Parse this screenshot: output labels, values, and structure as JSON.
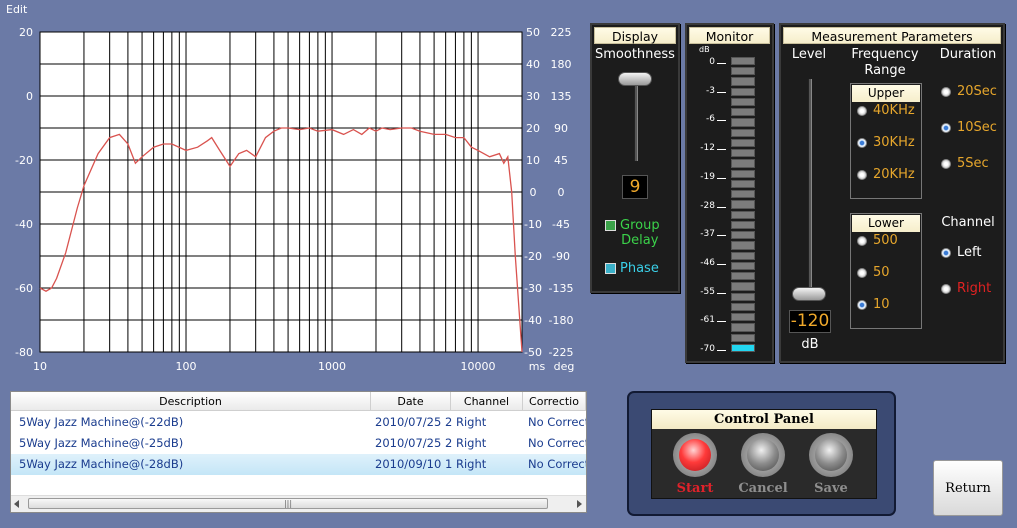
{
  "window": {
    "title": "Edit"
  },
  "chart_data": {
    "type": "line",
    "x_scale": "log",
    "xlim": [
      10,
      20000
    ],
    "x_tick_labels": [
      "10",
      "100",
      "1000",
      "10000"
    ],
    "x_unit_labels": [
      "ms",
      "deg"
    ],
    "y_left": {
      "ylim": [
        -80,
        20
      ],
      "tick_labels": [
        "20",
        "0",
        "-20",
        "-40",
        "-60",
        "-80"
      ]
    },
    "y_right_ms": {
      "ylim": [
        -50,
        50
      ],
      "tick_labels": [
        "50",
        "40",
        "30",
        "20",
        "10",
        "0",
        "-10",
        "-20",
        "-30",
        "-40",
        "-50"
      ]
    },
    "y_right_deg": {
      "ylim": [
        -225,
        225
      ],
      "tick_labels": [
        "225",
        "180",
        "135",
        "90",
        "45",
        "0",
        "-45",
        "-90",
        "-135",
        "-180",
        "-225"
      ]
    },
    "grid": true,
    "series": [
      {
        "color": "#d9534f",
        "x": [
          10,
          11,
          12,
          13,
          15,
          18,
          20,
          25,
          30,
          35,
          40,
          45,
          50,
          60,
          70,
          80,
          100,
          120,
          140,
          150,
          170,
          200,
          230,
          260,
          300,
          350,
          400,
          450,
          500,
          600,
          700,
          800,
          1000,
          1200,
          1400,
          1600,
          1800,
          2000,
          2200,
          2500,
          3000,
          3500,
          4000,
          5000,
          6000,
          7000,
          8000,
          9000,
          10000,
          12000,
          14000,
          15000,
          16000,
          17000,
          18000,
          20000
        ],
        "y": [
          -60,
          -61,
          -60,
          -57,
          -49,
          -35,
          -28,
          -18,
          -13,
          -12,
          -15,
          -21,
          -19,
          -16,
          -15,
          -15,
          -17,
          -16,
          -14,
          -13,
          -17,
          -22,
          -18,
          -17,
          -19,
          -13,
          -11,
          -10,
          -10,
          -10.5,
          -10,
          -11,
          -10.5,
          -12,
          -10.5,
          -12,
          -10,
          -11,
          -10,
          -10.5,
          -10,
          -10,
          -11,
          -12,
          -12,
          -13,
          -13,
          -16,
          -17,
          -19,
          -18,
          -21,
          -19,
          -30,
          -50,
          -80
        ]
      }
    ]
  },
  "display": {
    "title": "Display",
    "smoothness_label": "Smoothness",
    "smoothness_value": "9",
    "smoothness_fraction": 0.0,
    "group_delay_label": "Group\nDelay",
    "phase_label": "Phase"
  },
  "monitor": {
    "title": "Monitor",
    "db_label": "dB",
    "scale": [
      "0",
      "-3",
      "-6",
      "-12",
      "-19",
      "-28",
      "-37",
      "-46",
      "-55",
      "-61",
      "-70"
    ],
    "segments_total": 29,
    "segments_lit": 1,
    "lit_color": "#22d6f0",
    "unlit_color": "#7c7c7c"
  },
  "params": {
    "title": "Measurement Parameters",
    "level_label": "Level",
    "level_value": "-120",
    "level_unit": "dB",
    "level_fraction": 0.0,
    "freq_label": "Frequency\nRange",
    "upper_title": "Upper",
    "upper_options": [
      "40KHz",
      "30KHz",
      "20KHz"
    ],
    "upper_selected": "30KHz",
    "lower_title": "Lower",
    "lower_options": [
      "500",
      "50",
      "10"
    ],
    "lower_selected": "10",
    "duration_label": "Duration",
    "duration_options": [
      "20Sec",
      "10Sec",
      "5Sec"
    ],
    "duration_selected": "10Sec",
    "channel_label": "Channel",
    "channel_options": [
      "Left",
      "Right"
    ],
    "channel_selected": "Left"
  },
  "table": {
    "columns": [
      "Description",
      "Date",
      "Channel",
      "Correctio"
    ],
    "rows": [
      {
        "description": "5Way Jazz Machine@(-22dB)",
        "date": "2010/07/25 2",
        "channel": "Right",
        "correction": "No Correct",
        "selected": false
      },
      {
        "description": "5Way Jazz Machine@(-25dB)",
        "date": "2010/07/25 2",
        "channel": "Right",
        "correction": "No Correct",
        "selected": false
      },
      {
        "description": "5Way Jazz Machine@(-28dB)",
        "date": "2010/09/10 1",
        "channel": "Right",
        "correction": "No Correct",
        "selected": true
      }
    ]
  },
  "control_panel": {
    "title": "Control Panel",
    "start_label": "Start",
    "cancel_label": "Cancel",
    "save_label": "Save",
    "start_color": "#e0222a",
    "disabled_color": "#8e8e8e"
  },
  "return_label": "Return",
  "colors": {
    "background": "#6b7aa6",
    "plot_bg": "#ffffff",
    "curve": "#d9534f",
    "accent_orange": "#e6a62c",
    "group_delay": "#3bd24a",
    "phase": "#3ad0e8"
  }
}
